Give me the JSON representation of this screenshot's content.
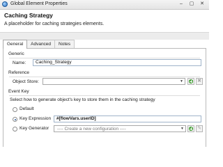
{
  "window": {
    "title": "Global Element Properties",
    "minimize": "–",
    "maximize": "▢",
    "close": "✕"
  },
  "header": {
    "title": "Caching Strategy",
    "description": "A placeholder for caching strategies elements."
  },
  "tabs": [
    {
      "label": "General"
    },
    {
      "label": "Advanced"
    },
    {
      "label": "Notes"
    }
  ],
  "generic": {
    "section_label": "Generic",
    "name_label": "Name:",
    "name_value": "Caching_Strategy"
  },
  "reference": {
    "section_label": "Reference",
    "object_store_label": "Object Store:",
    "object_store_value": ""
  },
  "event_key": {
    "section_label": "Event Key",
    "instruction": "Select how to generate object's key to store them in the caching strategy",
    "options": [
      {
        "label": "Default",
        "selected": false
      },
      {
        "label": "Key Expression",
        "selected": true
      },
      {
        "label": "Key Generator",
        "selected": false
      }
    ],
    "key_expression_value": "#[flowVars.userID]",
    "key_generator_placeholder": "---- Create a new configuration ----"
  }
}
